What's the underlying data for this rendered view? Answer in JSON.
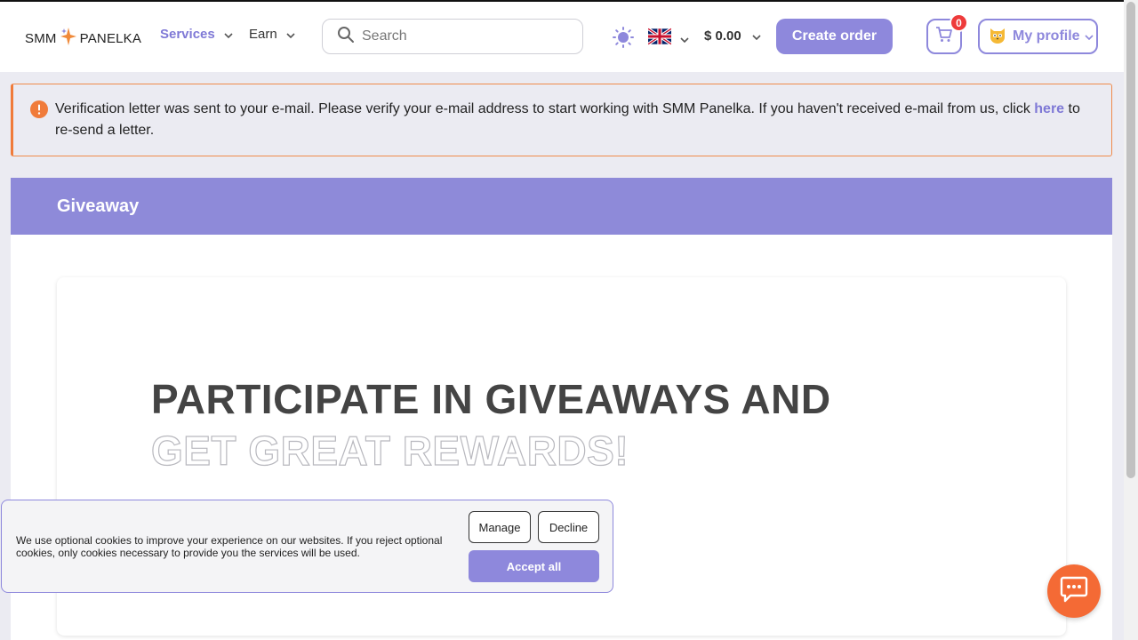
{
  "header": {
    "logo_left": "SMM",
    "logo_right": "PANELKA",
    "nav": [
      {
        "label": "Services",
        "active": true
      },
      {
        "label": "Earn",
        "active": false
      }
    ],
    "search_placeholder": "Search",
    "language": "English",
    "balance": "$ 0.00",
    "create_order_label": "Create order",
    "cart_count": "0",
    "profile_label": "My profile"
  },
  "alert": {
    "text_before_link": "Verification letter was sent to your e-mail. Please verify your e-mail address to start working with SMM Panelka. If you haven't received e-mail from us, click ",
    "link_label": "here",
    "text_after_link": " to re-send a letter."
  },
  "giveaway": {
    "section_title": "Giveaway",
    "headline_line1": "PARTICIPATE IN GIVEAWAYS AND",
    "headline_line2": "GET GREAT REWARDS!"
  },
  "cookie_banner": {
    "text": "We use optional cookies to improve your experience on our websites. If you reject optional cookies, only cookies necessary to provide you the services will be used.",
    "manage_label": "Manage",
    "decline_label": "Decline",
    "accept_label": "Accept all"
  },
  "colors": {
    "accent": "#8e88dc",
    "alert_border": "#f07b3a",
    "badge": "#ee3b3b",
    "chat": "#f46a35"
  },
  "icons": {
    "logo": "sparkle-star-icon",
    "search": "search-icon",
    "theme": "sun-icon",
    "flag": "uk-flag-icon",
    "cart": "cart-icon",
    "avatar": "cat-avatar-icon",
    "alert": "exclamation-icon",
    "chat": "chat-bubble-icon"
  }
}
